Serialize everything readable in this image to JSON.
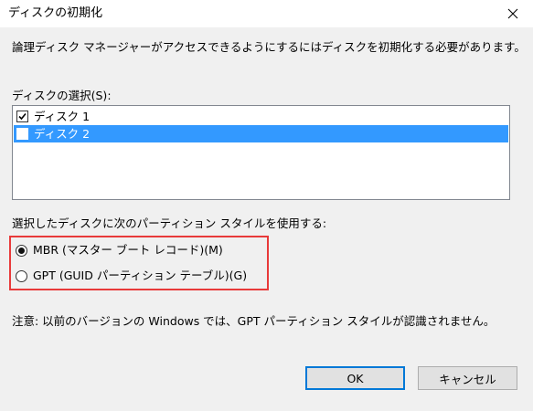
{
  "window": {
    "title": "ディスクの初期化"
  },
  "intro_text": "論理ディスク マネージャーがアクセスできるようにするにはディスクを初期化する必要があります。",
  "disk_select": {
    "label": "ディスクの選択(S):",
    "items": [
      {
        "label": "ディスク 1",
        "checked": true,
        "selected": false
      },
      {
        "label": "ディスク 2",
        "checked": false,
        "selected": true
      }
    ]
  },
  "partition": {
    "label": "選択したディスクに次のパーティション スタイルを使用する:",
    "options": [
      {
        "label": "MBR (マスター ブート レコード)(M)",
        "selected": true
      },
      {
        "label": "GPT (GUID パーティション テーブル)(G)",
        "selected": false
      }
    ]
  },
  "note": "注意: 以前のバージョンの Windows では、GPT パーティション スタイルが認識されません。",
  "buttons": {
    "ok": "OK",
    "cancel": "キャンセル"
  },
  "colors": {
    "selection": "#3399ff",
    "highlight_box": "#e83a3a",
    "default_button_border": "#0078d7",
    "dialog_bg": "#f0f0f0"
  }
}
